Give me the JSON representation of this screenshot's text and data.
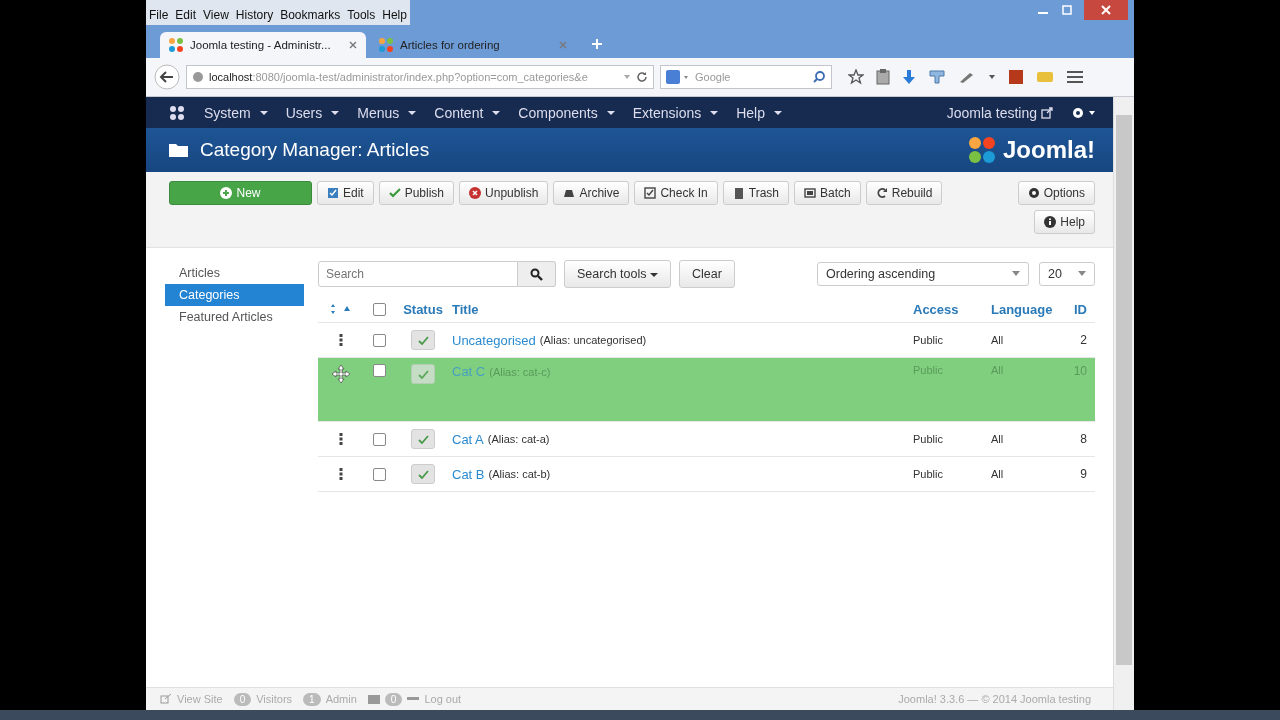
{
  "menu_bar": [
    "File",
    "Edit",
    "View",
    "History",
    "Bookmarks",
    "Tools",
    "Help"
  ],
  "tabs": [
    {
      "label": "Joomla testing - Administr...",
      "selected": true
    },
    {
      "label": "Articles for ordering",
      "selected": false
    }
  ],
  "address_bar": {
    "url_host": "localhost",
    "url_rest": ":8080/joomla-test/administrator/index.php?option=com_categories&e",
    "search_placeholder": "Google"
  },
  "admin_menu": {
    "items": [
      "System",
      "Users",
      "Menus",
      "Content",
      "Components",
      "Extensions",
      "Help"
    ],
    "site_link": "Joomla testing"
  },
  "header": {
    "title": "Category Manager: Articles",
    "logo": "Joomla!"
  },
  "toolbar": [
    {
      "kind": "new",
      "label": "New"
    },
    {
      "kind": "edit",
      "label": "Edit"
    },
    {
      "kind": "publish",
      "label": "Publish"
    },
    {
      "kind": "unpublish",
      "label": "Unpublish"
    },
    {
      "kind": "archive",
      "label": "Archive"
    },
    {
      "kind": "checkin",
      "label": "Check In"
    },
    {
      "kind": "trash",
      "label": "Trash"
    },
    {
      "kind": "batch",
      "label": "Batch"
    },
    {
      "kind": "rebuild",
      "label": "Rebuild"
    }
  ],
  "toolbar_right": [
    {
      "kind": "options",
      "label": "Options"
    },
    {
      "kind": "help",
      "label": "Help"
    }
  ],
  "sidebar": [
    {
      "label": "Articles",
      "selected": false
    },
    {
      "label": "Categories",
      "selected": true
    },
    {
      "label": "Featured Articles",
      "selected": false
    }
  ],
  "filters": {
    "search_placeholder": "Search",
    "search_tools": "Search tools",
    "clear": "Clear",
    "ordering": "Ordering ascending",
    "limit": "20"
  },
  "table": {
    "select_all_checked": false,
    "columns": [
      "Status",
      "Title",
      "Access",
      "Language",
      "ID"
    ],
    "rows": [
      {
        "title": "Uncategorised",
        "alias": "(Alias: uncategorised)",
        "access": "Public",
        "language": "All",
        "id": "2",
        "checked": false,
        "published": true,
        "dragging": false
      },
      {
        "title": "Cat C",
        "alias": "(Alias: cat-c)",
        "access": "Public",
        "language": "All",
        "id": "10",
        "checked": false,
        "published": true,
        "dragging": true
      },
      {
        "title": "Cat A",
        "alias": "(Alias: cat-a)",
        "access": "Public",
        "language": "All",
        "id": "8",
        "checked": false,
        "published": true,
        "dragging": false
      },
      {
        "title": "Cat B",
        "alias": "(Alias: cat-b)",
        "access": "Public",
        "language": "All",
        "id": "9",
        "checked": false,
        "published": true,
        "dragging": false
      }
    ]
  },
  "status_bar": {
    "items": [
      {
        "kind": "view-site",
        "label": "View Site"
      },
      {
        "kind": "visitors",
        "count": "0",
        "label": "Visitors"
      },
      {
        "kind": "admin",
        "count": "1",
        "label": "Admin"
      },
      {
        "kind": "messages",
        "count": "0"
      },
      {
        "kind": "logout",
        "label": "Log out"
      }
    ],
    "copyright": "Joomla! 3.3.6 — © 2014 Joomla testing"
  }
}
